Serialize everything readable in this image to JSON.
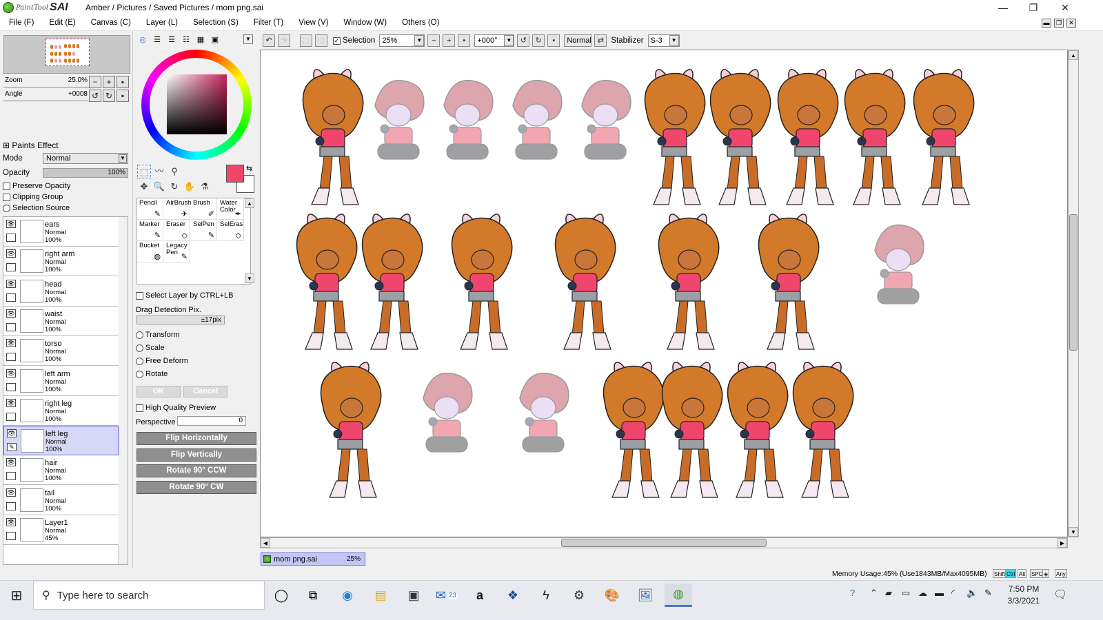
{
  "window": {
    "logo_small": "PaintTool",
    "logo_big": "SAI",
    "title_path": "Amber / Pictures / Saved Pictures / mom png.sai",
    "controls": [
      "—",
      "❐",
      "✕"
    ]
  },
  "menu": [
    "File (F)",
    "Edit (E)",
    "Canvas (C)",
    "Layer (L)",
    "Selection (S)",
    "Filter (T)",
    "View (V)",
    "Window (W)",
    "Others (O)"
  ],
  "navigator": {
    "zoom_label": "Zoom",
    "zoom_value": "25.0%",
    "angle_label": "Angle",
    "angle_value": "+0008"
  },
  "paints_effect": {
    "header": "Paints Effect",
    "mode_label": "Mode",
    "mode_value": "Normal",
    "opacity_label": "Opacity",
    "opacity_value": "100%",
    "opacity_fraction": 1.0,
    "preserve_opacity": "Preserve Opacity",
    "clipping_group": "Clipping Group",
    "selection_source": "Selection Source"
  },
  "layers": [
    {
      "name": "ears",
      "mode": "Normal",
      "opacity": "100%",
      "selected": false
    },
    {
      "name": "right arm",
      "mode": "Normal",
      "opacity": "100%",
      "selected": false
    },
    {
      "name": "head",
      "mode": "Normal",
      "opacity": "100%",
      "selected": false
    },
    {
      "name": "waist",
      "mode": "Normal",
      "opacity": "100%",
      "selected": false
    },
    {
      "name": "torso",
      "mode": "Normal",
      "opacity": "100%",
      "selected": false
    },
    {
      "name": "left arm",
      "mode": "Normal",
      "opacity": "100%",
      "selected": false
    },
    {
      "name": "right leg",
      "mode": "Normal",
      "opacity": "100%",
      "selected": false
    },
    {
      "name": "left leg",
      "mode": "Normal",
      "opacity": "100%",
      "selected": true
    },
    {
      "name": "hair",
      "mode": "Normal",
      "opacity": "100%",
      "selected": false
    },
    {
      "name": "tail",
      "mode": "Normal",
      "opacity": "100%",
      "selected": false
    },
    {
      "name": "Layer1",
      "mode": "Normal",
      "opacity": "45%",
      "selected": false
    }
  ],
  "color": {
    "foreground": "#f0466e",
    "background": "#ffffff"
  },
  "brushes": [
    {
      "name": "Pencil",
      "icon": "✎"
    },
    {
      "name": "AirBrush",
      "icon": "✈"
    },
    {
      "name": "Brush",
      "icon": "✐"
    },
    {
      "name": "Water Color",
      "icon": "✒"
    },
    {
      "name": "Marker",
      "icon": "✎"
    },
    {
      "name": "Eraser",
      "icon": "◇"
    },
    {
      "name": "SelPen",
      "icon": "✎"
    },
    {
      "name": "SelEras",
      "icon": "◇"
    },
    {
      "name": "Bucket",
      "icon": "◍"
    },
    {
      "name": "Legacy Pen",
      "icon": "✎"
    }
  ],
  "transform_panel": {
    "select_layer": "Select Layer by CTRL+LB",
    "drag_label": "Drag Detection Pix.",
    "drag_value": "±17pix",
    "options": [
      "Transform",
      "Scale",
      "Free Deform",
      "Rotate"
    ],
    "ok": "OK",
    "cancel": "Cancel",
    "hq_preview": "High Quality Preview",
    "perspective_label": "Perspective",
    "perspective_value": "0",
    "flip_h": "Flip Horizontally",
    "flip_v": "Flip Vertically",
    "rot_ccw": "Rotate 90° CCW",
    "rot_cw": "Rotate 90° CW"
  },
  "canvas_toolbar": {
    "selection_label": "Selection",
    "selection_checked": true,
    "zoom": "25%",
    "angle": "+000°",
    "blend": "Normal",
    "stabilizer_label": "Stabilizer",
    "stabilizer_value": "S-3"
  },
  "document_tab": {
    "name": "mom png.sai",
    "zoom": "25%"
  },
  "status": {
    "memory": "Memory Usage:45% (Use1843MB/Max4095MB)",
    "keys": [
      {
        "label": "Shift",
        "on": false
      },
      {
        "label": "Ctrl",
        "on": true
      },
      {
        "label": "Alt",
        "on": false
      },
      {
        "label": "SPC",
        "on": false
      },
      {
        "label": "◈",
        "on": false
      },
      {
        "label": "Any",
        "on": false
      }
    ]
  },
  "taskbar": {
    "search_placeholder": "Type here to search",
    "mail_badge": "23",
    "time": "7:50 PM",
    "date": "3/3/2021"
  }
}
